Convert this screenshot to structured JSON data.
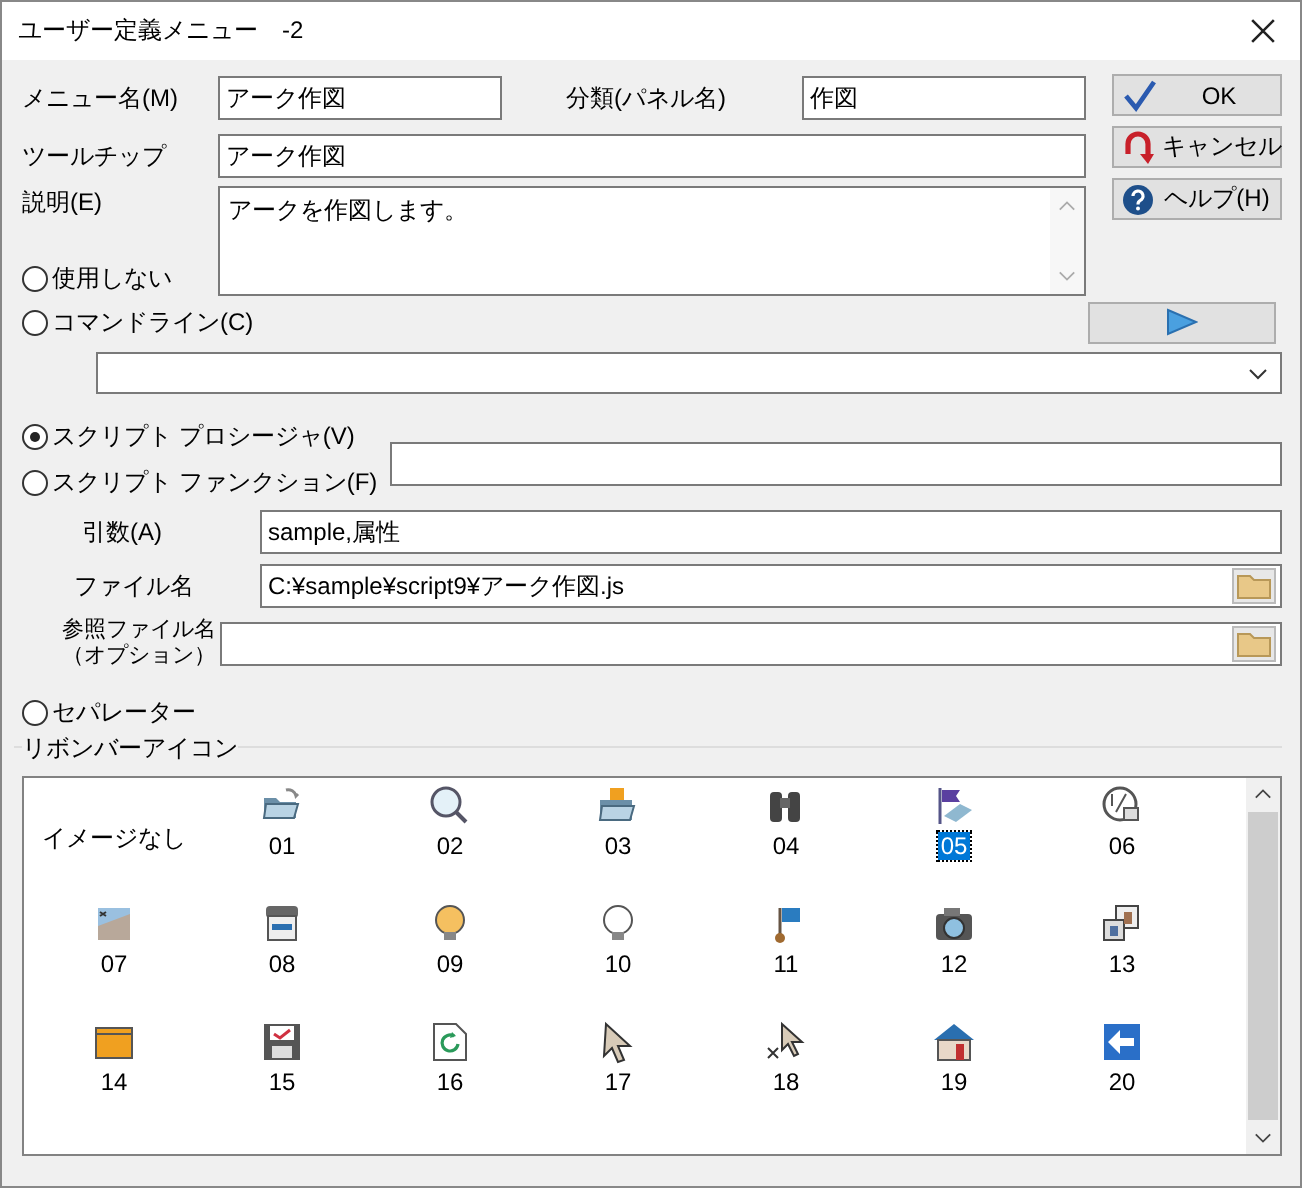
{
  "window": {
    "title": "ユーザー定義メニュー　-2"
  },
  "menu_name": {
    "label": "メニュー名(M)",
    "value": "アーク作図"
  },
  "category": {
    "label": "分類(パネル名)",
    "value": "作図"
  },
  "tooltip": {
    "label": "ツールチップ",
    "value": "アーク作図"
  },
  "description": {
    "label": "説明(E)",
    "value": "アークを作図します。"
  },
  "buttons": [
    {
      "kind": "ok",
      "label": "OK"
    },
    {
      "kind": "cancel",
      "label": "キャンセル"
    },
    {
      "kind": "help",
      "label": "ヘルプ(H)"
    }
  ],
  "modes": [
    {
      "label": "使用しない",
      "selected": false
    },
    {
      "label": "コマンドライン(C)",
      "selected": false
    },
    {
      "label": "スクリプト プロシージャ(V)",
      "selected": true
    },
    {
      "label": "スクリプト ファンクション(F)",
      "selected": false
    },
    {
      "label": "セパレーター",
      "selected": false
    }
  ],
  "arguments": {
    "label": "引数(A)",
    "value": "sample,属性"
  },
  "file_name": {
    "label": "ファイル名",
    "value": "C:¥sample¥script9¥アーク作図.js"
  },
  "ref_file_name": {
    "label": "参照ファイル名（オプション）"
  },
  "ribbon_icons": {
    "label": "リボンバーアイコン",
    "items": [
      {
        "kind": "none",
        "label": "イメージなし",
        "selected": false
      },
      {
        "kind": "icon",
        "label": "01",
        "selected": false
      },
      {
        "kind": "icon",
        "label": "02",
        "selected": false
      },
      {
        "kind": "icon",
        "label": "03",
        "selected": false
      },
      {
        "kind": "icon",
        "label": "04",
        "selected": false
      },
      {
        "kind": "icon",
        "label": "05",
        "selected": true
      },
      {
        "kind": "icon",
        "label": "06",
        "selected": false
      },
      {
        "kind": "icon",
        "label": "07",
        "selected": false
      },
      {
        "kind": "icon",
        "label": "08",
        "selected": false
      },
      {
        "kind": "icon",
        "label": "09",
        "selected": false
      },
      {
        "kind": "icon",
        "label": "10",
        "selected": false
      },
      {
        "kind": "icon",
        "label": "11",
        "selected": false
      },
      {
        "kind": "icon",
        "label": "12",
        "selected": false
      },
      {
        "kind": "icon",
        "label": "13",
        "selected": false
      },
      {
        "kind": "icon",
        "label": "14",
        "selected": false
      },
      {
        "kind": "icon",
        "label": "15",
        "selected": false
      },
      {
        "kind": "icon",
        "label": "16",
        "selected": false
      },
      {
        "kind": "icon",
        "label": "17",
        "selected": false
      },
      {
        "kind": "icon",
        "label": "18",
        "selected": false
      },
      {
        "kind": "icon",
        "label": "19",
        "selected": false
      },
      {
        "kind": "icon",
        "label": "20",
        "selected": false
      }
    ]
  }
}
